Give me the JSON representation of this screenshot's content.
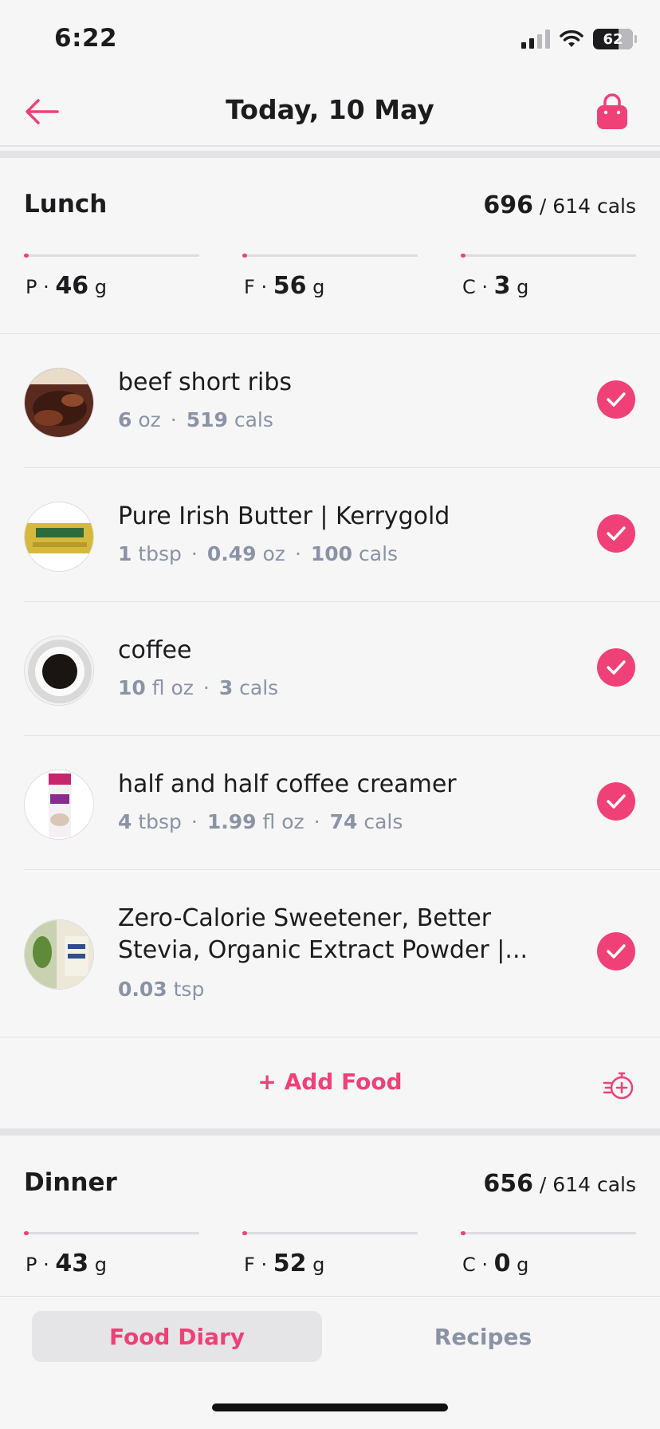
{
  "status_bar": {
    "time": "6:22",
    "battery": "62"
  },
  "header": {
    "title": "Today, 10 May"
  },
  "lunch": {
    "title": "Lunch",
    "cals_eaten": "696",
    "cals_target": "/ 614 cals",
    "macros": [
      {
        "letter": "P",
        "value": "46",
        "unit": "g"
      },
      {
        "letter": "F",
        "value": "56",
        "unit": "g"
      },
      {
        "letter": "C",
        "value": "3",
        "unit": "g"
      }
    ],
    "items": [
      {
        "name": "beef short ribs",
        "meta": [
          [
            "6",
            " oz"
          ],
          [
            "519",
            " cals"
          ]
        ],
        "icon": "beef-short-ribs-thumb"
      },
      {
        "name": "Pure Irish Butter | Kerrygold",
        "meta": [
          [
            "1",
            " tbsp"
          ],
          [
            "0.49",
            " oz"
          ],
          [
            "100",
            " cals"
          ]
        ],
        "icon": "kerrygold-butter-thumb"
      },
      {
        "name": "coffee",
        "meta": [
          [
            "10",
            " fl oz"
          ],
          [
            "3",
            " cals"
          ]
        ],
        "icon": "coffee-cup-thumb"
      },
      {
        "name": "half and half coffee creamer",
        "meta": [
          [
            "4",
            " tbsp"
          ],
          [
            "1.99",
            " fl oz"
          ],
          [
            "74",
            " cals"
          ]
        ],
        "icon": "creamer-carton-thumb"
      },
      {
        "name": "Zero-Calorie Sweetener, Better Stevia, Organic Extract Powder |...",
        "meta": [
          [
            "0.03",
            " tsp"
          ]
        ],
        "icon": "stevia-package-thumb"
      }
    ],
    "add_food_label": "+ Add Food"
  },
  "dinner": {
    "title": "Dinner",
    "cals_eaten": "656",
    "cals_target": "/ 614 cals",
    "macros": [
      {
        "letter": "P",
        "value": "43",
        "unit": "g"
      },
      {
        "letter": "F",
        "value": "52",
        "unit": "g"
      },
      {
        "letter": "C",
        "value": "0",
        "unit": "g"
      }
    ]
  },
  "tabs": {
    "food_diary": "Food Diary",
    "recipes": "Recipes"
  },
  "colors": {
    "accent": "#ef4177",
    "muted": "#8a93a6",
    "background": "#f6f6f7"
  }
}
